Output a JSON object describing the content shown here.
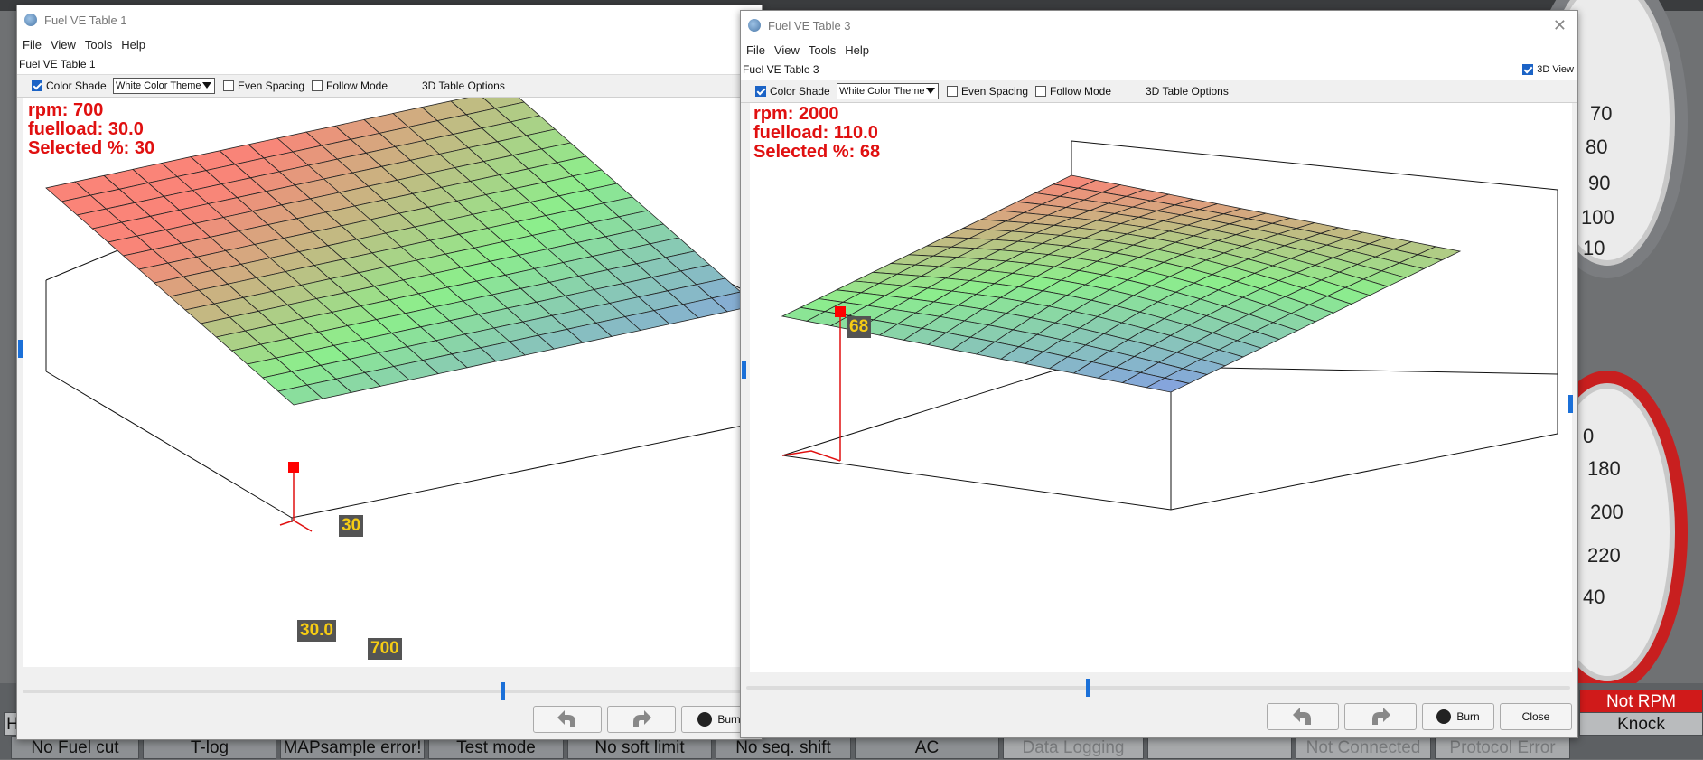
{
  "window1": {
    "title": "Fuel VE Table 1",
    "menu": [
      "File",
      "View",
      "Tools",
      "Help"
    ],
    "subtitle": "Fuel VE Table 1",
    "options": {
      "color_shade": "Color Shade",
      "theme": "White Color Theme",
      "even_spacing": "Even Spacing",
      "follow_mode": "Follow Mode",
      "table_options": "3D Table Options"
    },
    "info": {
      "rpm": "rpm: 700",
      "fuelload": "fuelload: 30.0",
      "selected": "Selected %: 30"
    },
    "point_value": "30",
    "axis_load": "30.0",
    "axis_rpm": "700",
    "burn_label": "Burn"
  },
  "window3": {
    "title": "Fuel VE Table 3",
    "menu": [
      "File",
      "View",
      "Tools",
      "Help"
    ],
    "subtitle": "Fuel VE Table 3",
    "view3d": "3D View",
    "options": {
      "color_shade": "Color Shade",
      "theme": "White Color Theme",
      "even_spacing": "Even Spacing",
      "follow_mode": "Follow Mode",
      "table_options": "3D Table Options"
    },
    "info": {
      "rpm": "rpm: 2000",
      "fuelload": "fuelload: 110.0",
      "selected": "Selected %: 68"
    },
    "point_value": "68",
    "burn_label": "Burn",
    "close_label": "Close"
  },
  "gauges": {
    "top": [
      "70",
      "80",
      "90",
      "100",
      "10"
    ],
    "bottom": [
      "0",
      "180",
      "200",
      "220",
      "40"
    ]
  },
  "status": [
    {
      "label": "No Fuel cut"
    },
    {
      "label": "T-log"
    },
    {
      "label": "MAPsample error!"
    },
    {
      "label": "Test mode"
    },
    {
      "label": "No soft limit"
    },
    {
      "label": "No seq. shift"
    },
    {
      "label": "AC"
    },
    {
      "label": "Data Logging"
    },
    {
      "label": ""
    },
    {
      "label": "Not Connected"
    },
    {
      "label": "Protocol Error"
    }
  ],
  "status_right": {
    "rpm_sync": "Not RPM synced",
    "knock": "Knock"
  },
  "status_left_char": "H",
  "colors": {
    "accent": "#1b70d8",
    "info_red": "#e01010",
    "tag_bg": "#545454",
    "tag_fg": "#f6cc14"
  }
}
